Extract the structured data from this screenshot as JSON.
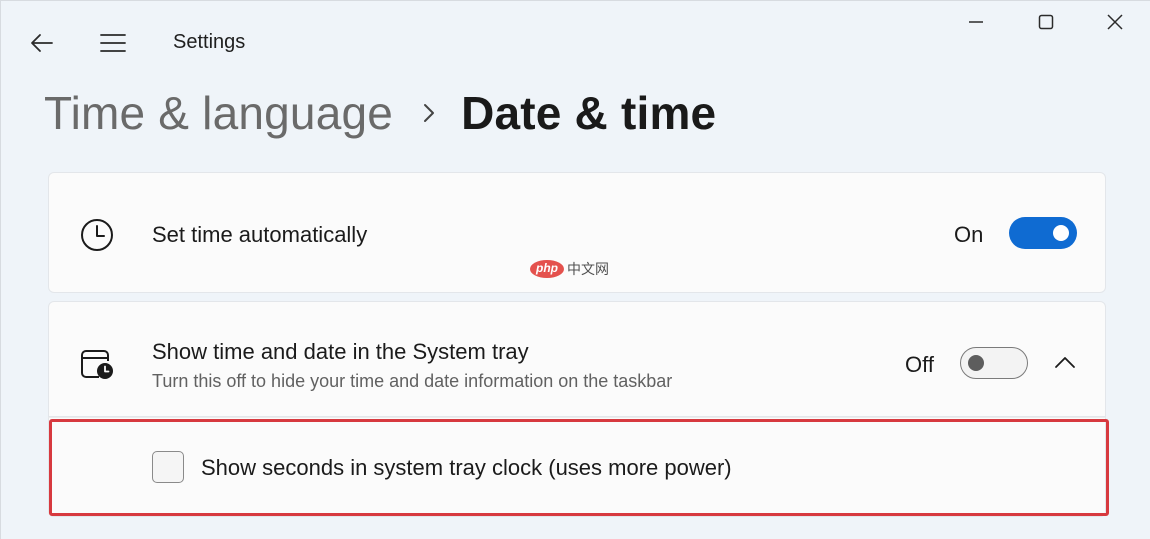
{
  "window": {
    "app_title": "Settings",
    "controls": {
      "minimize": "minimize",
      "maximize": "maximize",
      "close": "close"
    }
  },
  "breadcrumb": {
    "parent": "Time & language",
    "current": "Date & time"
  },
  "settings": {
    "set_time_auto": {
      "icon": "clock-icon",
      "title": "Set time automatically",
      "state_label": "On",
      "enabled": true
    },
    "show_tray_time": {
      "icon": "calendar-clock-icon",
      "title": "Show time and date in the System tray",
      "description": "Turn this off to hide your time and date information on the taskbar",
      "state_label": "Off",
      "enabled": false,
      "expanded": true
    },
    "show_seconds": {
      "label": "Show seconds in system tray clock (uses more power)",
      "checked": false
    }
  },
  "watermark": {
    "logo": "php",
    "text": "中文网"
  },
  "colors": {
    "accent": "#0f6bd2",
    "highlight": "#d7393f",
    "background": "#eff4f9"
  }
}
